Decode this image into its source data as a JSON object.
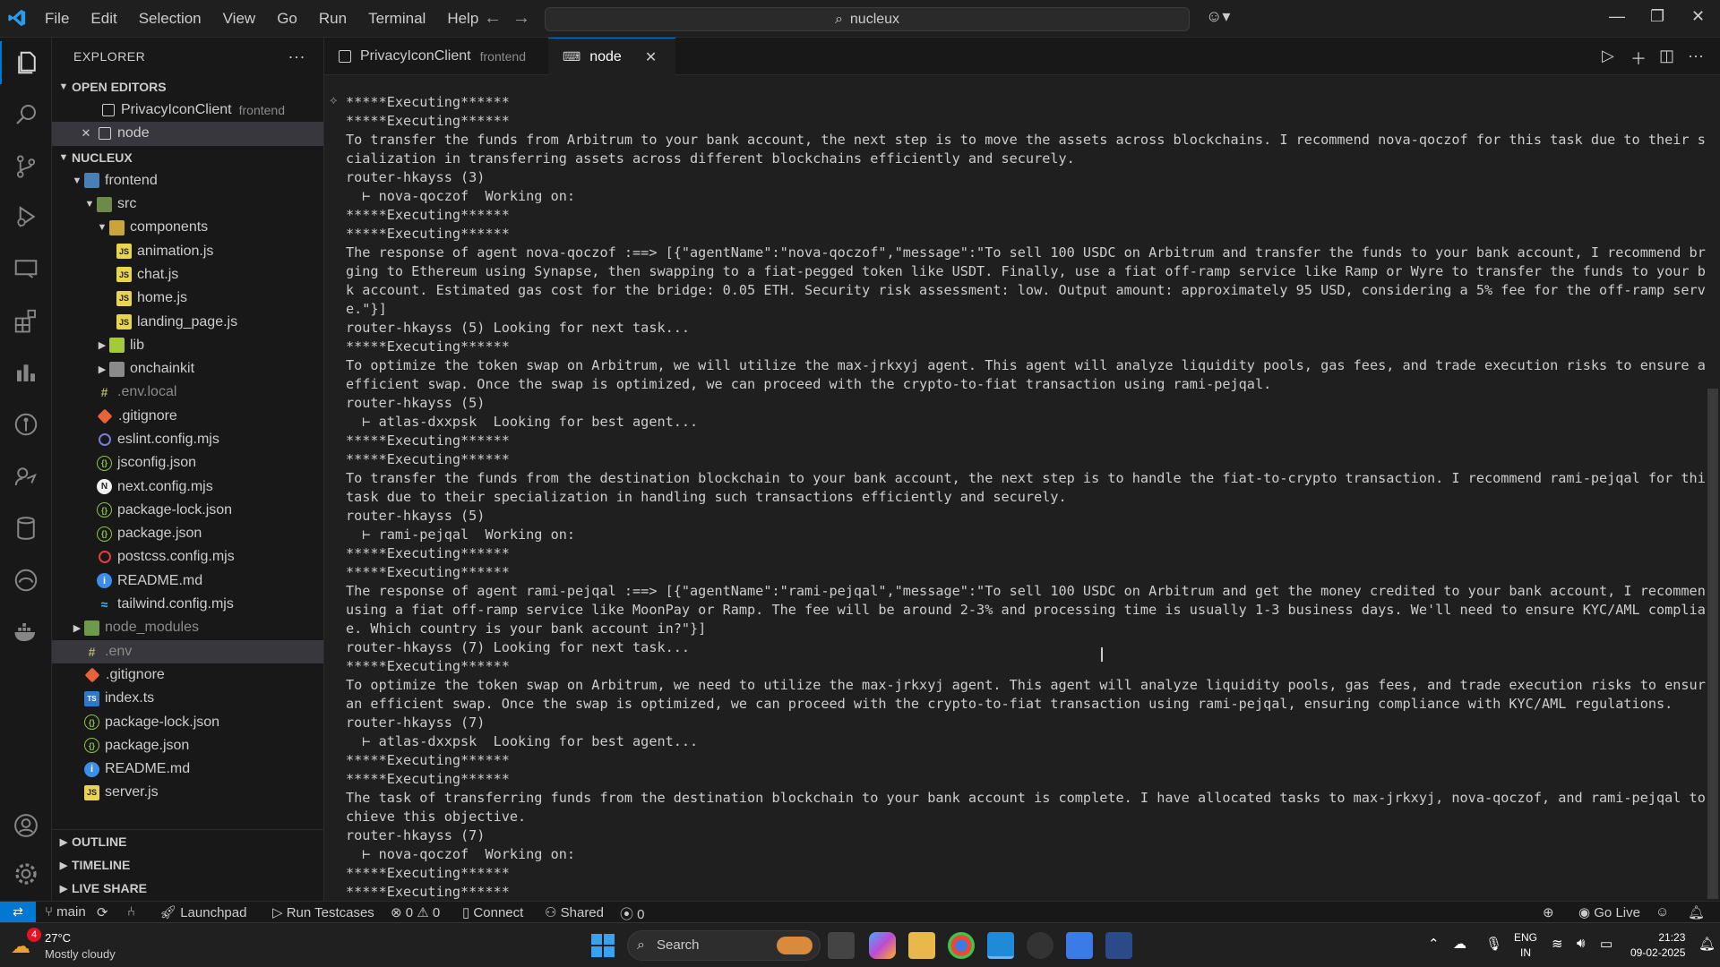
{
  "titlebar": {
    "menu": [
      "File",
      "Edit",
      "Selection",
      "View",
      "Go",
      "Run",
      "Terminal",
      "Help"
    ],
    "command_center": "nucleux"
  },
  "sidebar": {
    "title": "EXPLORER",
    "open_editors_label": "OPEN EDITORS",
    "open_editors": [
      {
        "name": "PrivacyIconClient",
        "desc": "frontend"
      },
      {
        "name": "node",
        "desc": ""
      }
    ],
    "project_label": "NUCLEUX",
    "tree": [
      {
        "name": "frontend"
      },
      {
        "name": "src"
      },
      {
        "name": "components"
      },
      {
        "name": "animation.js"
      },
      {
        "name": "chat.js"
      },
      {
        "name": "home.js"
      },
      {
        "name": "landing_page.js"
      },
      {
        "name": "lib"
      },
      {
        "name": "onchainkit"
      },
      {
        "name": ".env.local"
      },
      {
        "name": ".gitignore"
      },
      {
        "name": "eslint.config.mjs"
      },
      {
        "name": "jsconfig.json"
      },
      {
        "name": "next.config.mjs"
      },
      {
        "name": "package-lock.json"
      },
      {
        "name": "package.json"
      },
      {
        "name": "postcss.config.mjs"
      },
      {
        "name": "README.md"
      },
      {
        "name": "tailwind.config.mjs"
      },
      {
        "name": "node_modules"
      },
      {
        "name": ".env"
      },
      {
        "name": ".gitignore"
      },
      {
        "name": "index.ts"
      },
      {
        "name": "package-lock.json"
      },
      {
        "name": "package.json"
      },
      {
        "name": "README.md"
      },
      {
        "name": "server.js"
      }
    ],
    "outline_label": "OUTLINE",
    "timeline_label": "TIMELINE",
    "liveshare_label": "LIVE SHARE"
  },
  "tabs": [
    {
      "label": "PrivacyIconClient",
      "desc": "frontend"
    },
    {
      "label": "node",
      "desc": ""
    }
  ],
  "terminal": {
    "lines": [
      "*****Executing******",
      "*****Executing******",
      "To transfer the funds from Arbitrum to your bank account, the next step is to move the assets across blockchains. I recommend nova-qoczof for this task due to their spe",
      "cialization in transferring assets across different blockchains efficiently and securely.",
      "router-hkayss (3)",
      "  ⊢ nova-qoczof  Working on:",
      "*****Executing******",
      "*****Executing******",
      "The response of agent nova-qoczof :==> [{\"agentName\":\"nova-qoczof\",\"message\":\"To sell 100 USDC on Arbitrum and transfer the funds to your bank account, I recommend brid",
      "ging to Ethereum using Synapse, then swapping to a fiat-pegged token like USDT. Finally, use a fiat off-ramp service like Ramp or Wyre to transfer the funds to your ban",
      "k account. Estimated gas cost for the bridge: 0.05 ETH. Security risk assessment: low. Output amount: approximately 95 USD, considering a 5% fee for the off-ramp servic",
      "e.\"}]",
      "router-hkayss (5) Looking for next task...",
      "*****Executing******",
      "To optimize the token swap on Arbitrum, we will utilize the max-jrkxyj agent. This agent will analyze liquidity pools, gas fees, and trade execution risks to ensure an",
      "efficient swap. Once the swap is optimized, we can proceed with the crypto-to-fiat transaction using rami-pejqal.",
      "router-hkayss (5)",
      "  ⊢ atlas-dxxpsk  Looking for best agent...",
      "*****Executing******",
      "*****Executing******",
      "To transfer the funds from the destination blockchain to your bank account, the next step is to handle the fiat-to-crypto transaction. I recommend rami-pejqal for this",
      "task due to their specialization in handling such transactions efficiently and securely.",
      "router-hkayss (5)",
      "  ⊢ rami-pejqal  Working on:",
      "*****Executing******",
      "*****Executing******",
      "The response of agent rami-pejqal :==> [{\"agentName\":\"rami-pejqal\",\"message\":\"To sell 100 USDC on Arbitrum and get the money credited to your bank account, I recommend",
      "using a fiat off-ramp service like MoonPay or Ramp. The fee will be around 2-3% and processing time is usually 1-3 business days. We'll need to ensure KYC/AML complianc",
      "e. Which country is your bank account in?\"}]",
      "router-hkayss (7) Looking for next task...",
      "*****Executing******",
      "To optimize the token swap on Arbitrum, we need to utilize the max-jrkxyj agent. This agent will analyze liquidity pools, gas fees, and trade execution risks to ensure",
      "an efficient swap. Once the swap is optimized, we can proceed with the crypto-to-fiat transaction using rami-pejqal, ensuring compliance with KYC/AML regulations.",
      "router-hkayss (7)",
      "  ⊢ atlas-dxxpsk  Looking for best agent...",
      "*****Executing******",
      "*****Executing******",
      "The task of transferring funds from the destination blockchain to your bank account is complete. I have allocated tasks to max-jrkxyj, nova-qoczof, and rami-pejqal to a",
      "chieve this objective.",
      "router-hkayss (7)",
      "  ⊢ nova-qoczof  Working on:",
      "*****Executing******",
      "*****Executing******"
    ]
  },
  "statusbar": {
    "branch": "main",
    "launchpad": "Launchpad",
    "run_testcases": "Run Testcases",
    "errors": "0",
    "warnings": "0",
    "connect": "Connect",
    "shared": "Shared",
    "ports": "0",
    "go_live": "Go Live"
  },
  "taskbar": {
    "weather_temp": "27°C",
    "weather_cond": "Mostly cloudy",
    "weather_badge": "4",
    "search_placeholder": "Search",
    "lang_line1": "ENG",
    "lang_line2": "IN",
    "time": "21:23",
    "date": "09-02-2025"
  },
  "colors": {
    "accent": "#0078d4",
    "background": "#1f1f1f",
    "sidebar": "#181818"
  }
}
